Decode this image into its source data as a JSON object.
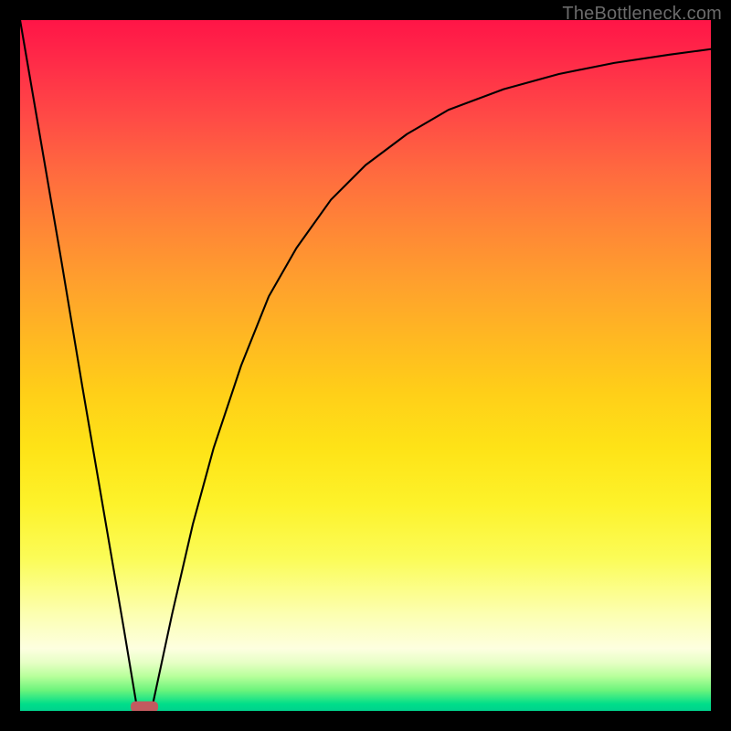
{
  "watermark": "TheBottleneck.com",
  "chart_data": {
    "type": "line",
    "title": "",
    "xlabel": "",
    "ylabel": "",
    "xlim": [
      0,
      100
    ],
    "ylim": [
      0,
      100
    ],
    "grid": false,
    "legend": false,
    "series": [
      {
        "name": "left-branch",
        "x": [
          0,
          3,
          6,
          9,
          12,
          15,
          17
        ],
        "y": [
          100,
          82.5,
          65,
          47,
          29.5,
          12,
          0
        ]
      },
      {
        "name": "right-branch",
        "x": [
          19,
          22,
          25,
          28,
          32,
          36,
          40,
          45,
          50,
          56,
          62,
          70,
          78,
          86,
          94,
          100
        ],
        "y": [
          0,
          14,
          27,
          38,
          50,
          60,
          67,
          74,
          79,
          83.5,
          87,
          90,
          92.2,
          93.8,
          95,
          95.8
        ]
      }
    ],
    "annotations": [
      {
        "name": "valley-marker",
        "x": 18,
        "y": 0.6,
        "shape": "rounded-rect",
        "color": "#c25a5f"
      }
    ],
    "gradient_stops": [
      {
        "pct": 0,
        "color": "#ff1547"
      },
      {
        "pct": 22,
        "color": "#ff6a3f"
      },
      {
        "pct": 46,
        "color": "#ffb822"
      },
      {
        "pct": 70,
        "color": "#fdf22a"
      },
      {
        "pct": 91,
        "color": "#fdffe0"
      },
      {
        "pct": 100,
        "color": "#00d28c"
      }
    ]
  }
}
